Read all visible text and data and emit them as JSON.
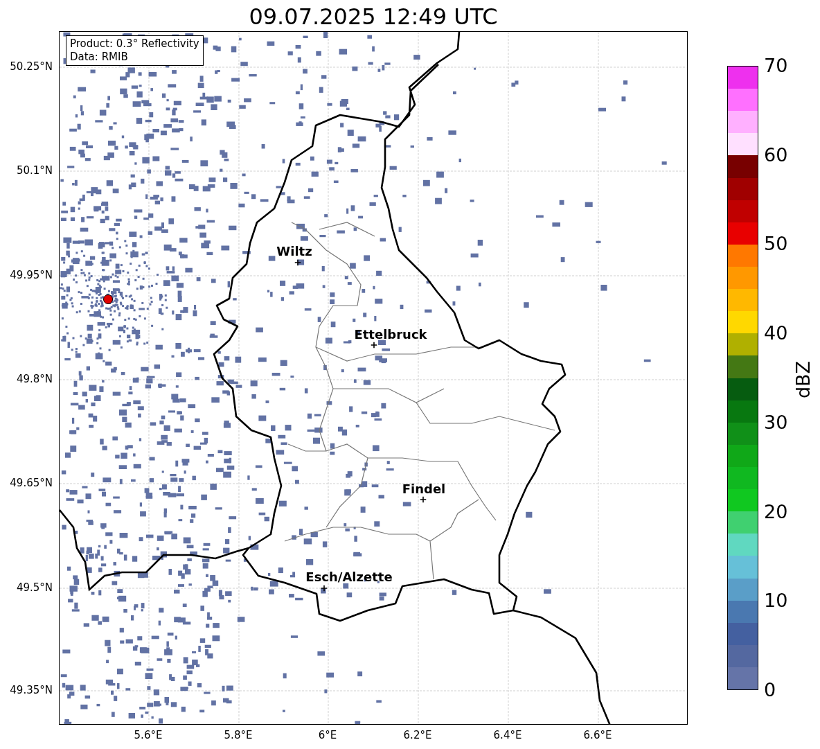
{
  "title": "09.07.2025 12:49 UTC",
  "info_box": [
    "Product: 0.3° Reflectivity",
    "Data: RMIB"
  ],
  "y_ticks": [
    "50.25°N",
    "50.1°N",
    "49.95°N",
    "49.8°N",
    "49.65°N",
    "49.5°N",
    "49.35°N"
  ],
  "x_ticks": [
    "5.6°E",
    "5.8°E",
    "6°E",
    "6.2°E",
    "6.4°E",
    "6.6°E"
  ],
  "places": [
    {
      "name": "Wiltz"
    },
    {
      "name": "Ettelbruck"
    },
    {
      "name": "Findel"
    },
    {
      "name": "Esch/Alzette"
    }
  ],
  "colorbar": {
    "label": "dBZ",
    "ticks": [
      "70",
      "60",
      "50",
      "40",
      "30",
      "20",
      "10",
      "0"
    ],
    "segments": [
      {
        "color": "#ee30ee"
      },
      {
        "color": "#ff70ff"
      },
      {
        "color": "#ffb0ff"
      },
      {
        "color": "#ffe0ff"
      },
      {
        "color": "#780000"
      },
      {
        "color": "#a00000"
      },
      {
        "color": "#c00000"
      },
      {
        "color": "#e80000"
      },
      {
        "color": "#ff7800"
      },
      {
        "color": "#ff9800"
      },
      {
        "color": "#ffb800"
      },
      {
        "color": "#ffd800"
      },
      {
        "color": "#b0b000"
      },
      {
        "color": "#447814"
      },
      {
        "color": "#065c10"
      },
      {
        "color": "#087810"
      },
      {
        "color": "#109018"
      },
      {
        "color": "#10a818"
      },
      {
        "color": "#10b820"
      },
      {
        "color": "#10c820"
      },
      {
        "color": "#40d070"
      },
      {
        "color": "#60d8c0"
      },
      {
        "color": "#66c0d8"
      },
      {
        "color": "#5a9ec8"
      },
      {
        "color": "#4a78b0"
      },
      {
        "color": "#4460a0"
      },
      {
        "color": "#5468a0"
      },
      {
        "color": "#6574a8"
      }
    ]
  }
}
